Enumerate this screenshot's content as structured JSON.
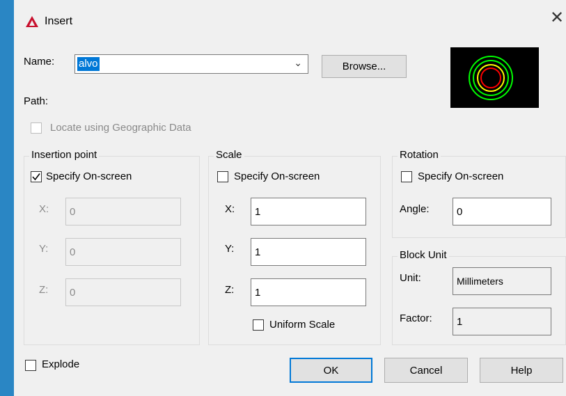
{
  "dialog": {
    "title": "Insert",
    "name_label": "Name:",
    "name_value": "alvo",
    "browse_label": "Browse...",
    "path_label": "Path:",
    "geo_label": "Locate using Geographic Data"
  },
  "insertion": {
    "legend": "Insertion point",
    "specify_label": "Specify On-screen",
    "specify_checked": true,
    "x_label": "X:",
    "x_value": "0",
    "y_label": "Y:",
    "y_value": "0",
    "z_label": "Z:",
    "z_value": "0"
  },
  "scale": {
    "legend": "Scale",
    "specify_label": "Specify On-screen",
    "specify_checked": false,
    "x_label": "X:",
    "x_value": "1",
    "y_label": "Y:",
    "y_value": "1",
    "z_label": "Z:",
    "z_value": "1",
    "uniform_label": "Uniform Scale"
  },
  "rotation": {
    "legend": "Rotation",
    "specify_label": "Specify On-screen",
    "specify_checked": false,
    "angle_label": "Angle:",
    "angle_value": "0"
  },
  "block_unit": {
    "legend": "Block Unit",
    "unit_label": "Unit:",
    "unit_value": "Millimeters",
    "factor_label": "Factor:",
    "factor_value": "1"
  },
  "footer": {
    "explode_label": "Explode",
    "ok_label": "OK",
    "cancel_label": "Cancel",
    "help_label": "Help"
  },
  "preview": {
    "ring_colors": [
      "#00ff00",
      "#ffff00",
      "#ff0000"
    ]
  },
  "icons": {
    "app": "autocad-icon",
    "close": "close-icon",
    "dropdown": "chevron-down-icon"
  },
  "colors": {
    "selection": "#0078d7",
    "app_icon": "#c8102e"
  }
}
